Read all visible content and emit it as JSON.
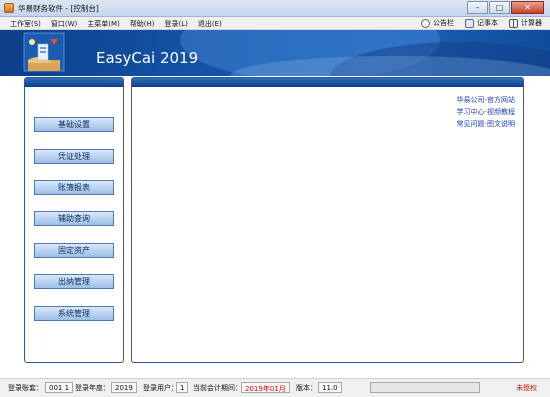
{
  "window": {
    "title": "华易财务软件 - [控制台]",
    "controls": {
      "minimize": "–",
      "maximize": "□",
      "close": "✕"
    }
  },
  "menu": {
    "items": [
      "工作室(S)",
      "窗口(W)",
      "主菜单(M)",
      "帮助(H)",
      "登录(L)",
      "退出(E)"
    ]
  },
  "tools": [
    {
      "label": "公告栏",
      "icon": "bulletin-icon"
    },
    {
      "label": "记事本",
      "icon": "notepad-icon"
    },
    {
      "label": "计算器",
      "icon": "calculator-icon"
    }
  ],
  "banner": {
    "title": "EasyCai 2019"
  },
  "modules": [
    "基础设置",
    "凭证处理",
    "账簿报表",
    "辅助查询",
    "固定资产",
    "出纳管理",
    "系统管理"
  ],
  "links": [
    "华易公司-官方网站",
    "学习中心-视频教程",
    "常见问题-图文说明"
  ],
  "status": {
    "account_set_label": "登录账套：",
    "account_set": "001 1",
    "year_label": "登录年度：",
    "year": "2019",
    "user_label": "登录用户：",
    "user": "1",
    "period_label": "当前会计期间：",
    "period": "2019年01月",
    "version_label": "版本：",
    "version": "11.0",
    "authorization": "未授权"
  },
  "colors": {
    "banner": "#1455a9",
    "panel_header": "#0c3d86",
    "link": "#1d3fbf",
    "alert": "#d01010"
  }
}
